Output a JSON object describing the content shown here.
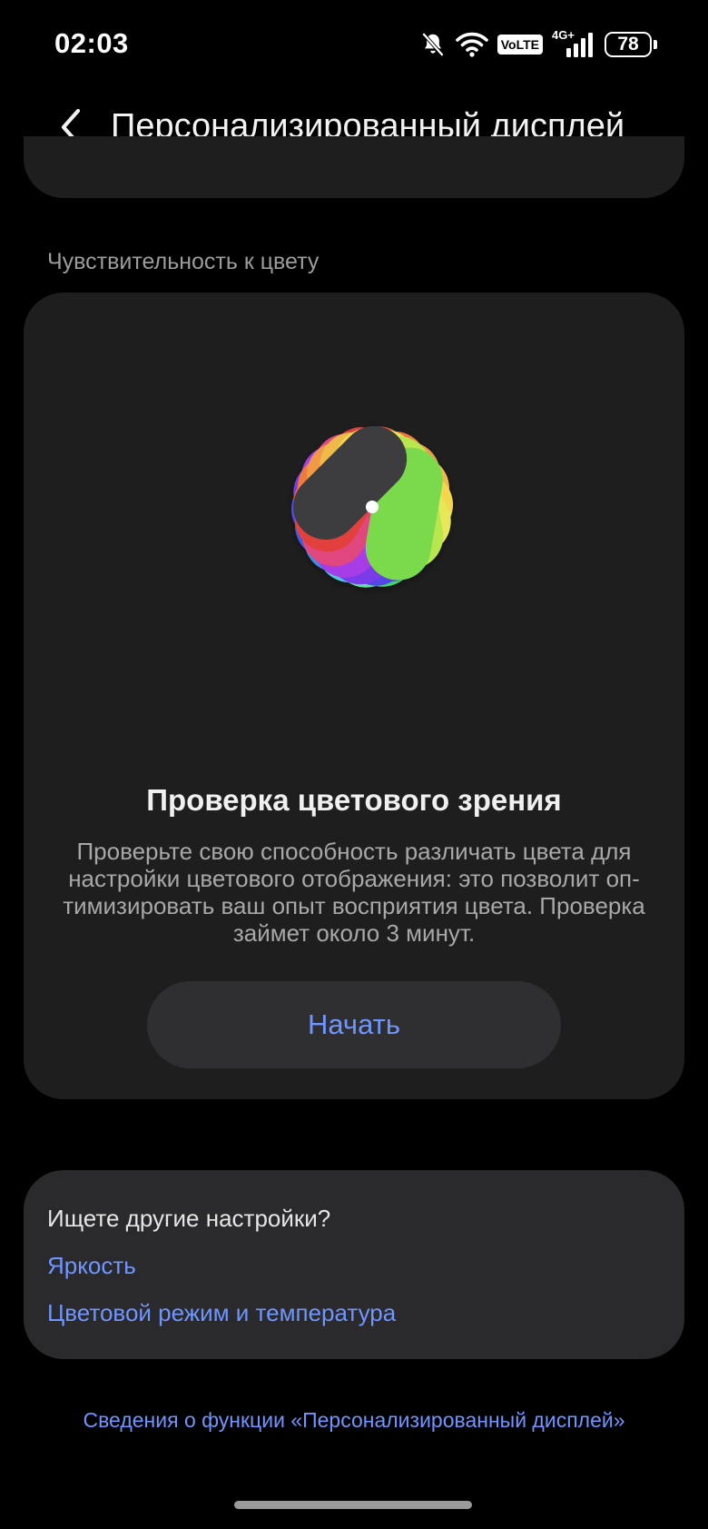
{
  "status_bar": {
    "time": "02:03",
    "network": "4G+",
    "volte": "VoLTE",
    "battery": "78",
    "icons": [
      "bell-off-icon",
      "wifi-icon",
      "volte-icon",
      "signal-icon",
      "battery-icon"
    ]
  },
  "header": {
    "title": "Персонализированный дисплей",
    "back_icon": "chevron-left-icon"
  },
  "section": {
    "label": "Чувствительность к цвету"
  },
  "test_card": {
    "illustration": "color-fan-icon",
    "title": "Проверка цветового зрения",
    "description_lines": [
      "Проверьте свою способность различать цвета для",
      "настройки цветового отображения: это позволит оп-",
      "тимизировать ваш опыт восприятия цвета. Проверка",
      "займет около 3 минут."
    ],
    "start_label": "Начать",
    "accent_color": "#6f95ff"
  },
  "more_settings": {
    "heading": "Ищете другие настройки?",
    "links": [
      "Яркость",
      "Цветовой режим и температура"
    ]
  },
  "footer_link": "Сведения о функции «Персонализированный дисплей»"
}
